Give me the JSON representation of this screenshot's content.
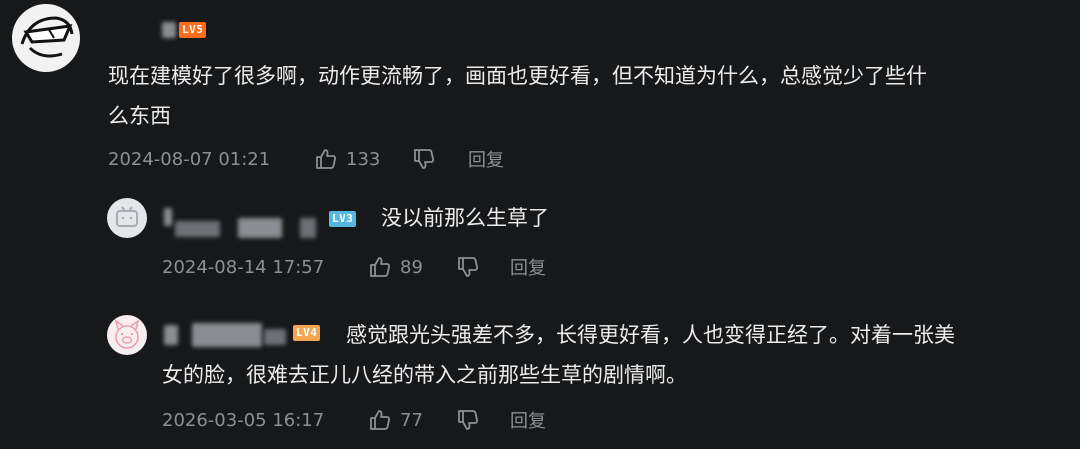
{
  "comments": [
    {
      "level": "LV5",
      "text_line1": "现在建模好了很多啊，动作更流畅了，画面也更好看，但不知道为什么，总感觉少了些什",
      "text_line2": "么东西",
      "time": "2024-08-07 01:21",
      "likes": "133",
      "reply_label": "回复"
    },
    {
      "level": "LV3",
      "text": "没以前那么生草了",
      "time": "2024-08-14 17:57",
      "likes": "89",
      "reply_label": "回复"
    },
    {
      "level": "LV4",
      "text_line1": "感觉跟光头强差不多，长得更好看，人也变得正经了。对着一张美",
      "text_line2": "女的脸，很难去正儿八经的带入之前那些生草的剧情啊。",
      "time": "2026-03-05 16:17",
      "likes": "77",
      "reply_label": "回复"
    }
  ],
  "colors": {
    "background": "#17181a",
    "text": "#ececec",
    "meta": "#8d8f93"
  },
  "icons": [
    "avatar-sketch",
    "avatar-tv",
    "avatar-pig",
    "thumb-up-icon",
    "thumb-down-icon"
  ]
}
